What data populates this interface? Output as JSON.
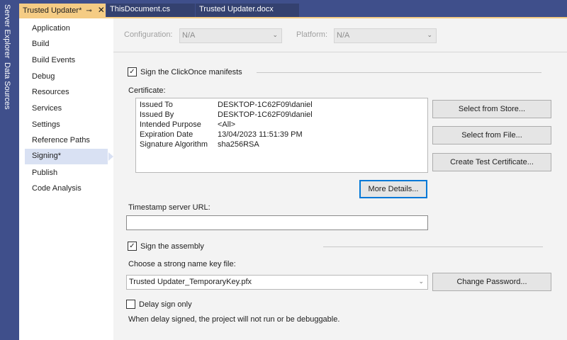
{
  "side_tabs": [
    "Server Explorer",
    "Data Sources"
  ],
  "tabs": [
    {
      "label": "Trusted Updater*",
      "pin": "⊸",
      "close": "✕"
    },
    {
      "label": "ThisDocument.cs"
    },
    {
      "label": "Trusted Updater.docx"
    }
  ],
  "nav": {
    "items": [
      "Application",
      "Build",
      "Build Events",
      "Debug",
      "Resources",
      "Services",
      "Settings",
      "Reference Paths",
      "Signing*",
      "Publish",
      "Code Analysis"
    ],
    "selected": "Signing*"
  },
  "config": {
    "configuration_label": "Configuration:",
    "configuration_value": "N/A",
    "platform_label": "Platform:",
    "platform_value": "N/A"
  },
  "signing": {
    "sign_manifests_label": "Sign the ClickOnce manifests",
    "sign_manifests_checked": true,
    "certificate_label": "Certificate:",
    "certificate": [
      {
        "key": "Issued To",
        "value": "DESKTOP-1C62F09\\daniel"
      },
      {
        "key": "Issued By",
        "value": "DESKTOP-1C62F09\\daniel"
      },
      {
        "key": "Intended Purpose",
        "value": "<All>"
      },
      {
        "key": "Expiration Date",
        "value": "13/04/2023 11:51:39 PM"
      },
      {
        "key": "Signature Algorithm",
        "value": "sha256RSA"
      }
    ],
    "select_from_store": "Select from Store...",
    "select_from_file": "Select from File...",
    "create_test_certificate": "Create Test Certificate...",
    "more_details": "More Details...",
    "timestamp_label": "Timestamp server URL:",
    "timestamp_value": "",
    "sign_assembly_label": "Sign the assembly",
    "sign_assembly_checked": true,
    "key_file_label": "Choose a strong name key file:",
    "key_file_value": "Trusted Updater_TemporaryKey.pfx",
    "change_password": "Change Password...",
    "delay_sign_label": "Delay sign only",
    "delay_sign_checked": false,
    "delay_note": "When delay signed, the project will not run or be debuggable."
  },
  "colors": {
    "accent_tab": "#f5cc84",
    "chrome": "#3f4f8b",
    "selected_nav": "#d9e1f3",
    "focus": "#0078d7"
  }
}
